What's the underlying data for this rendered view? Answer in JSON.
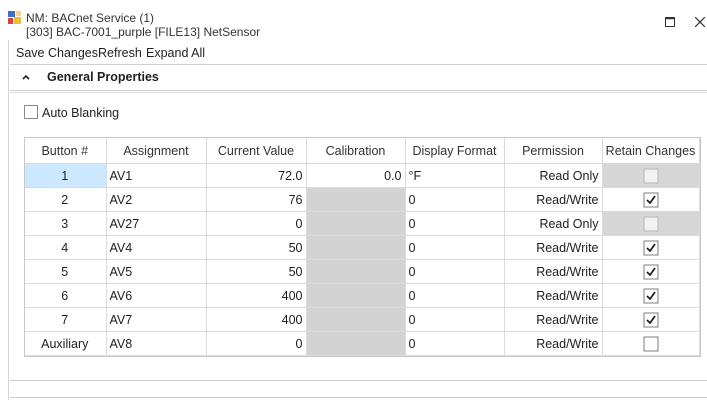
{
  "window": {
    "title_line1": "NM: BACnet Service (1)",
    "title_line2": "[303] BAC-7001_purple [FILE13] NetSensor",
    "app_icon": "network-manager-icon",
    "maximize_icon": "maximize-icon",
    "close_icon": "close-icon"
  },
  "toolbar": {
    "save_label": "Save Changes",
    "refresh_label": "Refresh",
    "expand_label": "Expand All"
  },
  "section": {
    "title": "General Properties",
    "chevron_icon": "chevron-up-icon"
  },
  "auto_blanking": {
    "label": "Auto Blanking",
    "checked": false
  },
  "grid": {
    "columns": [
      "Button #",
      "Assignment",
      "Current Value",
      "Calibration",
      "Display Format",
      "Permission",
      "Retain Changes"
    ],
    "rows": [
      {
        "button": "1",
        "assignment": "AV1",
        "value": "72.0",
        "calibration": "0.0",
        "format": "°F",
        "permission": "Read Only",
        "retain": false,
        "retain_enabled": false,
        "calibration_enabled": true,
        "selected": true
      },
      {
        "button": "2",
        "assignment": "AV2",
        "value": "76",
        "calibration": "",
        "format": "0",
        "permission": "Read/Write",
        "retain": true,
        "retain_enabled": true,
        "calibration_enabled": false,
        "selected": false
      },
      {
        "button": "3",
        "assignment": "AV27",
        "value": "0",
        "calibration": "",
        "format": "0",
        "permission": "Read Only",
        "retain": false,
        "retain_enabled": false,
        "calibration_enabled": false,
        "selected": false
      },
      {
        "button": "4",
        "assignment": "AV4",
        "value": "50",
        "calibration": "",
        "format": "0",
        "permission": "Read/Write",
        "retain": true,
        "retain_enabled": true,
        "calibration_enabled": false,
        "selected": false
      },
      {
        "button": "5",
        "assignment": "AV5",
        "value": "50",
        "calibration": "",
        "format": "0",
        "permission": "Read/Write",
        "retain": true,
        "retain_enabled": true,
        "calibration_enabled": false,
        "selected": false
      },
      {
        "button": "6",
        "assignment": "AV6",
        "value": "400",
        "calibration": "",
        "format": "0",
        "permission": "Read/Write",
        "retain": true,
        "retain_enabled": true,
        "calibration_enabled": false,
        "selected": false
      },
      {
        "button": "7",
        "assignment": "AV7",
        "value": "400",
        "calibration": "",
        "format": "0",
        "permission": "Read/Write",
        "retain": true,
        "retain_enabled": true,
        "calibration_enabled": false,
        "selected": false
      },
      {
        "button": "Auxiliary",
        "assignment": "AV8",
        "value": "0",
        "calibration": "",
        "format": "0",
        "permission": "Read/Write",
        "retain": false,
        "retain_enabled": true,
        "calibration_enabled": false,
        "selected": false
      }
    ]
  },
  "colors": {
    "disabled_cell": "#d3d3d3",
    "selected_cell": "#cce8ff"
  }
}
